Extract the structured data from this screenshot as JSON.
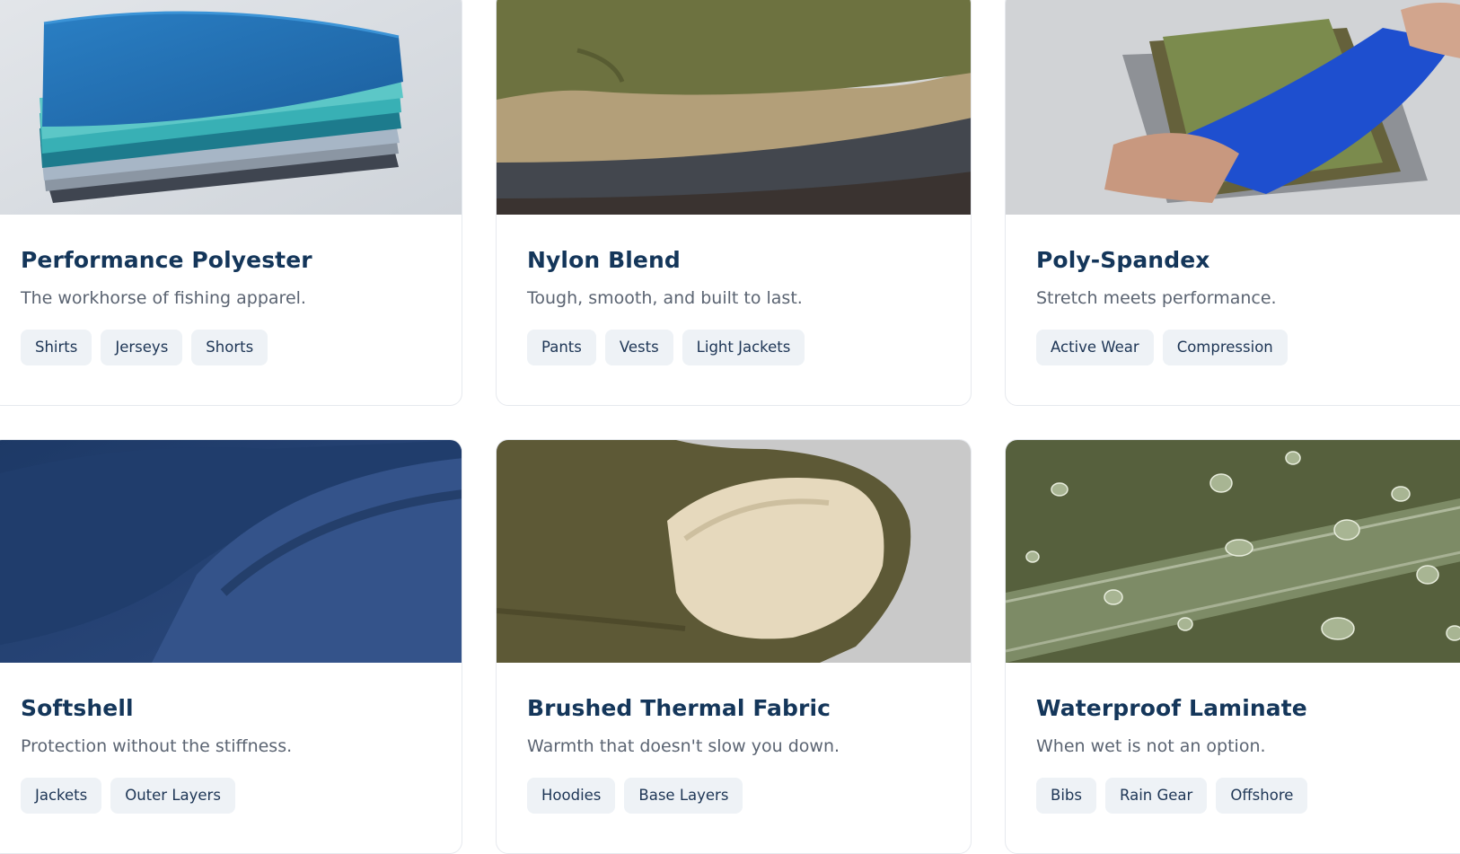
{
  "cards": [
    {
      "title": "Performance Polyester",
      "description": "The workhorse of fishing apparel.",
      "tags": [
        "Shirts",
        "Jerseys",
        "Shorts"
      ],
      "image": "stacked-blue-teal-polyester-fabric",
      "colors": [
        "#1f6fb0",
        "#3ab3b5",
        "#5a6672"
      ]
    },
    {
      "title": "Nylon Blend",
      "description": "Tough, smooth, and built to last.",
      "tags": [
        "Pants",
        "Vests",
        "Light Jackets"
      ],
      "image": "stacked-olive-khaki-charcoal-nylon-fabric",
      "colors": [
        "#6f7342",
        "#b6a27c",
        "#3d3f45"
      ]
    },
    {
      "title": "Poly-Spandex",
      "description": "Stretch meets performance.",
      "tags": [
        "Active Wear",
        "Compression"
      ],
      "image": "hands-stretching-blue-spandex-fabric",
      "colors": [
        "#1d4ed0",
        "#6c7f45",
        "#8a8e94"
      ]
    },
    {
      "title": "Softshell",
      "description": "Protection without the stiffness.",
      "tags": [
        "Jackets",
        "Outer Layers"
      ],
      "image": "navy-fleece-softshell-fabric",
      "colors": [
        "#233f6f",
        "#2f4d80"
      ]
    },
    {
      "title": "Brushed Thermal Fabric",
      "description": "Warmth that doesn't slow you down.",
      "tags": [
        "Hoodies",
        "Base Layers"
      ],
      "image": "olive-brushed-fleece-with-cream-lining",
      "colors": [
        "#5e5a37",
        "#e6d9bd",
        "#c8c8c8"
      ]
    },
    {
      "title": "Waterproof Laminate",
      "description": "When wet is not an option.",
      "tags": [
        "Bibs",
        "Rain Gear",
        "Offshore"
      ],
      "image": "olive-waterproof-fabric-with-water-droplets",
      "colors": [
        "#55603d",
        "#7e8a60"
      ]
    }
  ]
}
